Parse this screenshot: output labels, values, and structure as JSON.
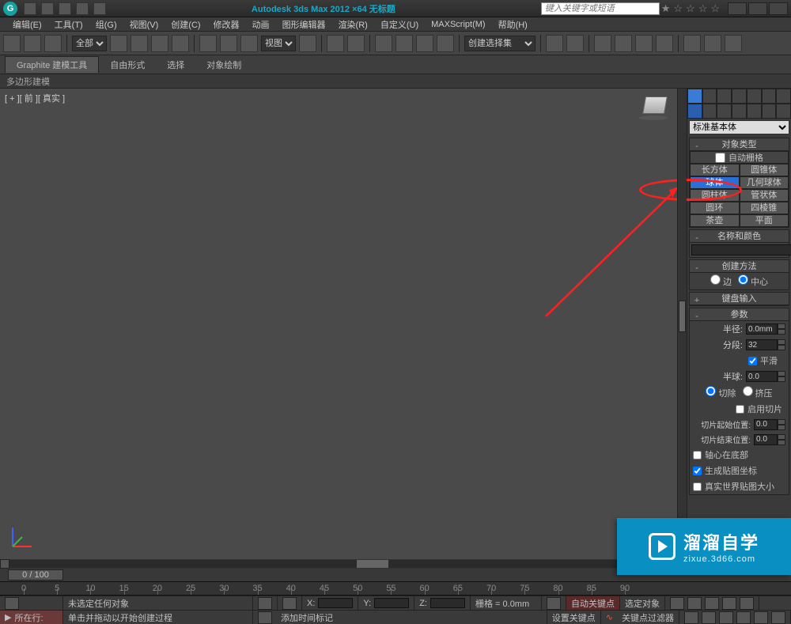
{
  "title_bar": {
    "app_title": "Autodesk 3ds Max 2012 ×64   无标题",
    "search_placeholder": "键入关键字或短语"
  },
  "menu": {
    "items": [
      "编辑(E)",
      "工具(T)",
      "组(G)",
      "视图(V)",
      "创建(C)",
      "修改器",
      "动画",
      "图形编辑器",
      "渲染(R)",
      "自定义(U)",
      "MAXScript(M)",
      "帮助(H)"
    ]
  },
  "toolbar": {
    "scope_select": "全部",
    "view_select": "视图",
    "selection_set": "创建选择集"
  },
  "ribbon": {
    "tabs": [
      "Graphite 建模工具",
      "自由形式",
      "选择",
      "对象绘制"
    ],
    "sub": "多边形建模"
  },
  "viewport": {
    "label": "[ + ][ 前 ][ 真实 ]"
  },
  "cmd_panel": {
    "category": "标准基本体",
    "object_type_header": "对象类型",
    "auto_grid": "自动栅格",
    "primitives": {
      "box": "长方体",
      "cone": "圆锥体",
      "sphere": "球体",
      "geosphere": "几何球体",
      "cylinder": "圆柱体",
      "tube": "管状体",
      "torus": "圆环",
      "pyramid": "四棱锥",
      "teapot": "茶壶",
      "plane": "平面"
    },
    "name_color_header": "名称和颜色",
    "create_method_header": "创建方法",
    "create_method": {
      "edge": "边",
      "center": "中心"
    },
    "keyboard_entry_header": "键盘输入",
    "params_header": "参数",
    "params": {
      "radius_label": "半径:",
      "radius_value": "0.0mm",
      "segments_label": "分段:",
      "segments_value": "32",
      "smooth": "平滑",
      "hemisphere_label": "半球:",
      "hemisphere_value": "0.0",
      "chop": "切除",
      "squash": "挤压",
      "slice_on": "启用切片",
      "slice_from_label": "切片起始位置:",
      "slice_from_value": "0.0",
      "slice_to_label": "切片结束位置:",
      "slice_to_value": "0.0",
      "base_pivot": "轴心在底部",
      "gen_map": "生成贴图坐标",
      "real_world": "真实世界贴图大小"
    }
  },
  "time": {
    "slider_label": "0 / 100",
    "ticks": [
      0,
      5,
      10,
      15,
      20,
      25,
      30,
      35,
      40,
      45,
      50,
      55,
      60,
      65,
      70,
      75,
      80,
      85,
      90
    ]
  },
  "status": {
    "no_selection": "未选定任何对象",
    "hint": "单击并拖动以开始创建过程",
    "add_time_tag": "添加时间标记",
    "grid": "栅格 = 0.0mm",
    "auto_key": "自动关键点",
    "set_key": "设置关键点",
    "sel_lock": "选定对象",
    "key_filters": "关键点过滤器",
    "x": "X:",
    "y": "Y:",
    "z": "Z:",
    "script_label": "所在行:"
  },
  "watermark": {
    "big": "溜溜自学",
    "small": "zixue.3d66.com"
  }
}
